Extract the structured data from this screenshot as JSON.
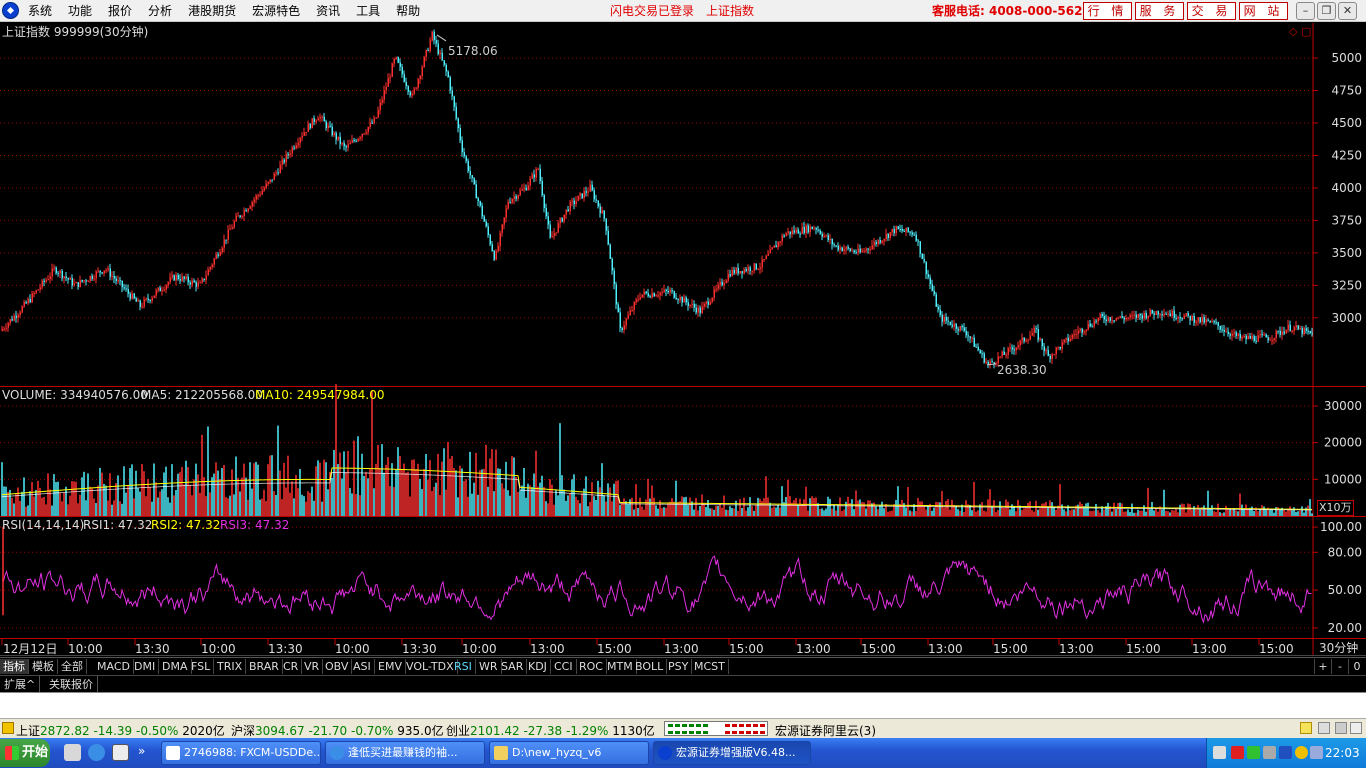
{
  "menu": [
    "系统",
    "功能",
    "报价",
    "分析",
    "港股期货",
    "宏源特色",
    "资讯",
    "工具",
    "帮助"
  ],
  "header": {
    "login_status": "闪电交易已登录",
    "current_index": "上证指数",
    "hotline": "客服电话: 4008-000-562",
    "nav_buttons": [
      "行 情",
      "服 务",
      "交 易",
      "网 站"
    ]
  },
  "window_controls": [
    "–",
    "❐",
    "✕"
  ],
  "chart_panel": {
    "title": "上证指数 999999(30分钟)",
    "high_label": "5178.06",
    "low_label": "2638.30",
    "volume_label": "VOLUME: 334940576.00",
    "ma5_label": "MA5: 212205568.00",
    "ma10_label": "MA10: 249547984.00",
    "volume_unit": "X10万",
    "rsi_label": "RSI(14,14,14)",
    "rsi1_label": "RSI1: 47.32",
    "rsi2_label": "RSI2: 47.32",
    "rsi3_label": "RSI3: 47.32",
    "period_label": "30分钟"
  },
  "chart_data": {
    "type": "candlestick-line",
    "title": "上证指数 999999(30分钟)",
    "price_axis": {
      "ylim": [
        2475,
        5270
      ],
      "ticks": [
        3000,
        3250,
        3500,
        3750,
        4000,
        4250,
        4500,
        4750,
        5000
      ]
    },
    "volume_axis": {
      "ylim": [
        0,
        33000
      ],
      "ticks": [
        10000,
        20000,
        30000
      ]
    },
    "rsi_axis": {
      "ylim": [
        12,
        108
      ],
      "ticks": [
        20.0,
        50.0,
        80.0,
        100.0
      ]
    },
    "price_anchors": [
      [
        0,
        2900
      ],
      [
        25,
        3100
      ],
      [
        55,
        3380
      ],
      [
        75,
        3250
      ],
      [
        105,
        3380
      ],
      [
        140,
        3090
      ],
      [
        175,
        3320
      ],
      [
        200,
        3250
      ],
      [
        235,
        3750
      ],
      [
        270,
        4050
      ],
      [
        300,
        4400
      ],
      [
        318,
        4560
      ],
      [
        345,
        4300
      ],
      [
        375,
        4520
      ],
      [
        395,
        5000
      ],
      [
        412,
        4700
      ],
      [
        432,
        5178
      ],
      [
        448,
        4850
      ],
      [
        462,
        4300
      ],
      [
        478,
        3900
      ],
      [
        495,
        3450
      ],
      [
        508,
        3900
      ],
      [
        525,
        4000
      ],
      [
        538,
        4150
      ],
      [
        550,
        3600
      ],
      [
        568,
        3850
      ],
      [
        590,
        4000
      ],
      [
        605,
        3750
      ],
      [
        620,
        2900
      ],
      [
        640,
        3180
      ],
      [
        670,
        3200
      ],
      [
        700,
        3050
      ],
      [
        730,
        3350
      ],
      [
        760,
        3400
      ],
      [
        785,
        3650
      ],
      [
        815,
        3700
      ],
      [
        835,
        3550
      ],
      [
        860,
        3500
      ],
      [
        895,
        3680
      ],
      [
        915,
        3650
      ],
      [
        940,
        3000
      ],
      [
        965,
        2900
      ],
      [
        988,
        2638
      ],
      [
        1012,
        2760
      ],
      [
        1035,
        2900
      ],
      [
        1048,
        2700
      ],
      [
        1075,
        2880
      ],
      [
        1100,
        3000
      ],
      [
        1130,
        3000
      ],
      [
        1160,
        3050
      ],
      [
        1190,
        3000
      ],
      [
        1215,
        2950
      ],
      [
        1240,
        2840
      ],
      [
        1270,
        2850
      ],
      [
        1290,
        2930
      ],
      [
        1312,
        2870
      ]
    ],
    "rsi_level_last": 47.32,
    "x_ticks": [
      "12月12日",
      "10:00",
      "13:30",
      "10:00",
      "13:30",
      "10:00",
      "13:30",
      "10:00",
      "13:00",
      "15:00",
      "13:00",
      "15:00",
      "13:00",
      "15:00",
      "13:00",
      "15:00",
      "13:00",
      "15:00",
      "13:00",
      "15:00"
    ]
  },
  "indicator_tabs": [
    "MACD",
    "DMI",
    "DMA",
    "FSL",
    "TRIX",
    "BRAR",
    "CR",
    "VR",
    "OBV",
    "ASI",
    "EMV",
    "VOL-TDX",
    "RSI",
    "WR",
    "SAR",
    "KDJ",
    "CCI",
    "ROC",
    "MTM",
    "BOLL",
    "PSY",
    "MCST"
  ],
  "active_indicator": "RSI",
  "category_tabs": [
    "指标",
    "模板",
    "全部"
  ],
  "zoom_controls": [
    "+",
    "-",
    "0"
  ],
  "ext_tabs": [
    "扩展^",
    "关联报价"
  ],
  "status": {
    "sh": {
      "name": "上证",
      "price": "2872.82",
      "change": "-14.39",
      "pct": "-0.50%",
      "amount": "2020亿"
    },
    "sz": {
      "name": "沪深",
      "price": "3094.67",
      "change": "-21.70",
      "pct": "-0.70%",
      "amount": "935.0亿"
    },
    "cy": {
      "name": "创业",
      "price": "2101.42",
      "change": "-27.38",
      "pct": "-1.29%",
      "amount": "1130亿"
    },
    "server": "宏源证券阿里云(3)"
  },
  "taskbar": {
    "start": "开始",
    "windows": [
      "2746988: FXCM-USDDe...",
      "逢低买进最赚钱的袖...",
      "D:\\new_hyzq_v6",
      "宏源证券增强版V6.48..."
    ],
    "clock": "22:03"
  },
  "colors": {
    "up": "#ff3030",
    "down": "#50f0ff",
    "ma": "#ffff00",
    "rsi": "#e030e0",
    "grid": "#a00000",
    "axis": "#c00000"
  }
}
